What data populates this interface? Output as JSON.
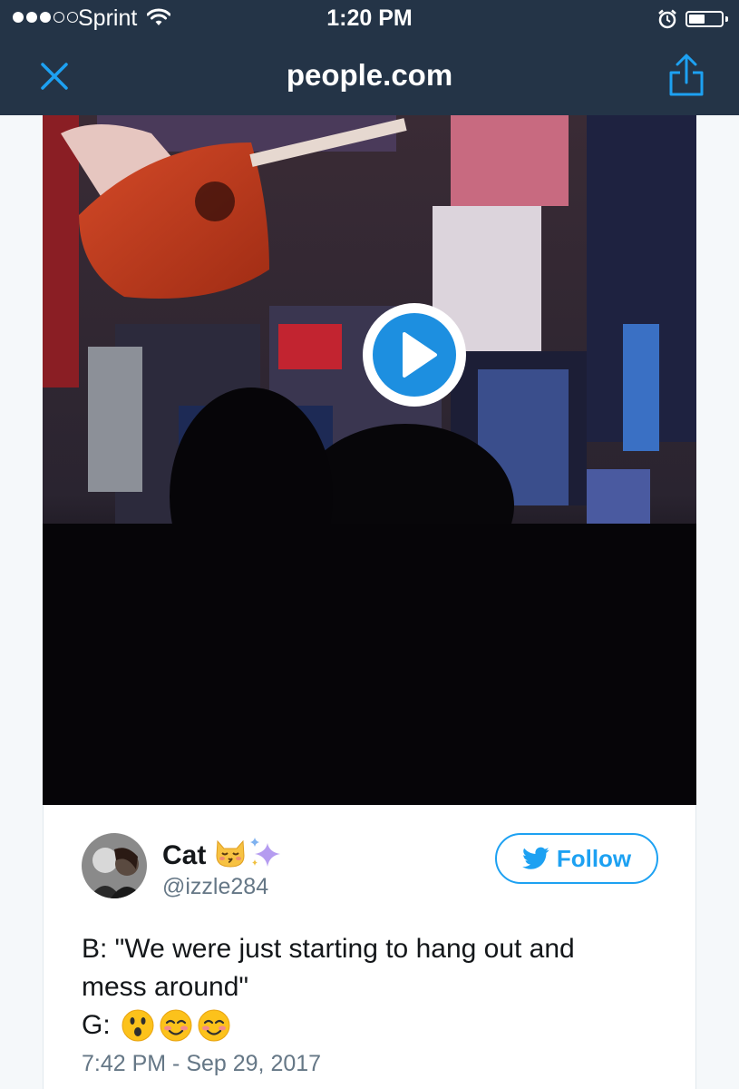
{
  "status_bar": {
    "carrier": "Sprint",
    "time": "1:20 PM",
    "signal_bars_filled": 3,
    "signal_bars_total": 5,
    "battery_level": 0.5,
    "icons": [
      "signal-dots",
      "wifi-icon",
      "alarm-icon",
      "battery-icon"
    ]
  },
  "browser": {
    "domain": "people.com",
    "close_icon": "close-icon",
    "share_icon": "share-icon"
  },
  "video": {
    "play_icon": "play-icon"
  },
  "tweet": {
    "display_name": "Cat",
    "name_emojis": [
      "kissing-cat-emoji",
      "sparkles-emoji"
    ],
    "handle": "@izzle284",
    "follow_label": "Follow",
    "text_line1": "B: \"We were just starting to hang out and",
    "text_line2": "mess around\"",
    "text_line3_prefix": "G:",
    "reaction_emojis": [
      "astonished-face-emoji",
      "smiling-blush-emoji",
      "smiling-blush-emoji"
    ],
    "timestamp": "7:42 PM - Sep 29, 2017"
  },
  "colors": {
    "header_bg": "#243447",
    "accent": "#1da1f2",
    "text_primary": "#14171a",
    "text_secondary": "#657786"
  }
}
